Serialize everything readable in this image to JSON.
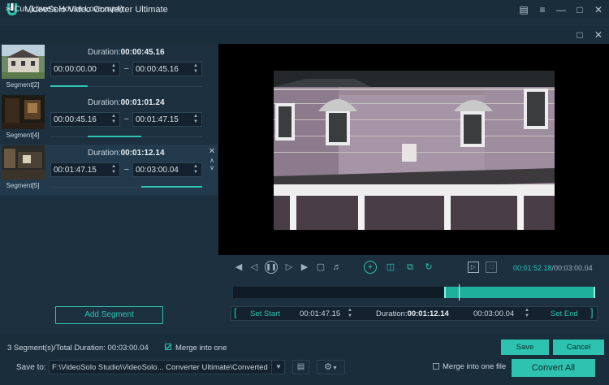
{
  "app": {
    "title": "VideoSolo Video Converter Ultimate",
    "accent": "#2ec3b0"
  },
  "cut_window": {
    "title": "Cut (Lowe's House Love.mp4)",
    "icon": "scissors-icon"
  },
  "segments": [
    {
      "label": "Segment[2]",
      "duration_prefix": "Duration:",
      "duration": "00:00:45.16",
      "start": "00:00:00.00",
      "end": "00:00:45.16",
      "selected": false
    },
    {
      "label": "Segment[4]",
      "duration_prefix": "Duration:",
      "duration": "00:01:01.24",
      "start": "00:00:45.16",
      "end": "00:01:47.15",
      "selected": false
    },
    {
      "label": "Segment[5]",
      "duration_prefix": "Duration:",
      "duration": "00:01:12.14",
      "start": "00:01:47.15",
      "end": "00:03:00.04",
      "selected": true
    }
  ],
  "add_segment_label": "Add Segment",
  "player": {
    "current_time": "00:01:52.18",
    "total_time": "/00:03:00.04",
    "icons": [
      "skip-start-icon",
      "step-back-icon",
      "pause-icon",
      "step-forward-icon",
      "skip-end-icon",
      "stop-icon",
      "volume-icon",
      "add-segment-icon",
      "copy-segment-icon",
      "duplicate-icon",
      "reset-icon",
      "play-selection-icon",
      "stop-selection-icon"
    ]
  },
  "trim": {
    "set_start": "Set Start",
    "start": "00:01:47.15",
    "duration_label": "Duration:",
    "duration": "00:01:12.14",
    "end": "00:03:00.04",
    "set_end": "Set End"
  },
  "footer": {
    "total": "3 Segment(s)/Total Duration: 00:03:00.04",
    "merge_label": "Merge into one",
    "merge_checked": true,
    "save": "Save",
    "cancel": "Cancel",
    "save_to_label": "Save to:",
    "path": "F:\\VideoSolo Studio\\VideoSolo... Converter Ultimate\\Converted",
    "merge_file_label": "Merge into one file",
    "merge_file_checked": false,
    "convert_all": "Convert All"
  }
}
